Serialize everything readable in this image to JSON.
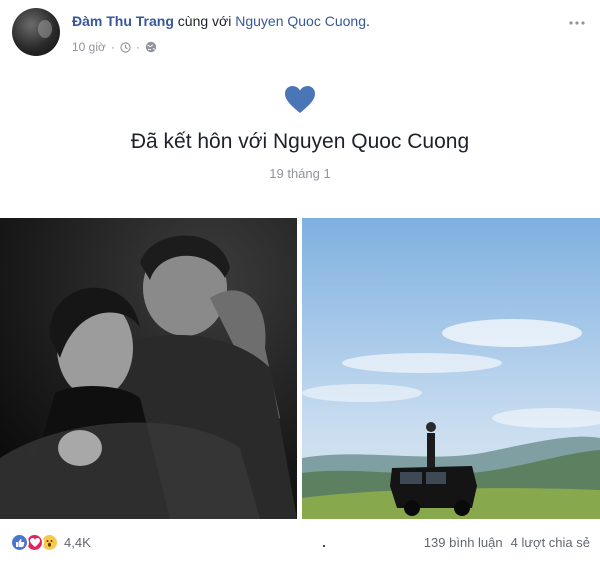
{
  "post": {
    "author": "Đàm Thu Trang",
    "with_text": "cùng với",
    "tagged": "Nguyen Quoc Cuong",
    "header_dot": ".",
    "time": "10 giờ",
    "separator": "·",
    "more_icon": "more-horizontal-icon",
    "privacy_icon": "globe-icon",
    "time_icon": "clock-icon"
  },
  "life_event": {
    "icon": "heart-icon",
    "title": "Đã kết hôn với Nguyen Quoc Cuong",
    "date": "19 tháng 1",
    "heart_color": "#4a76b8"
  },
  "photos": [
    {
      "description": "black-and-white couple portrait"
    },
    {
      "description": "person standing on top of black SUV on mountain"
    }
  ],
  "footer": {
    "reactions": [
      "like",
      "love",
      "wow"
    ],
    "reaction_count": "4,4K",
    "comments": "139 bình luận",
    "shares": "4 lượt chia sẻ"
  },
  "colors": {
    "link": "#365899",
    "meta": "#90949c",
    "text": "#1d2129"
  }
}
